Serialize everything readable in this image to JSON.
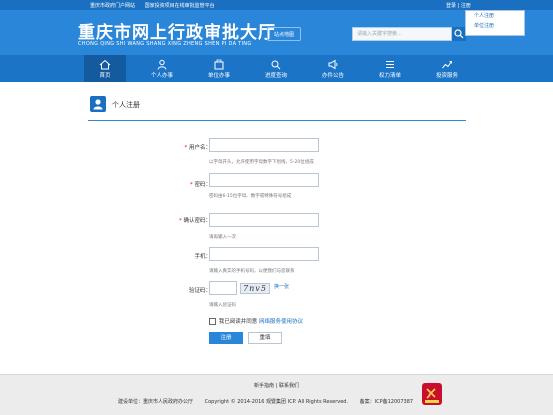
{
  "topbar": {
    "portal": "重庆市政府门户网站",
    "platform": "国家投资项目在线审批监管平台",
    "login": "登录",
    "sep": "|",
    "register": "注册"
  },
  "register_dropdown": {
    "personal": "个人注册",
    "entity": "单位注册"
  },
  "header": {
    "logo_cn": "重庆市网上行政审批大厅",
    "logo_en": "CHONG QING SHI WANG SHANG XING ZHENG SHEN PI DA TING",
    "sitemap": "站点地图",
    "search_placeholder": "请输入关键字搜索..."
  },
  "nav": [
    {
      "label": "首页",
      "icon": "home-icon"
    },
    {
      "label": "个人办事",
      "icon": "person-icon"
    },
    {
      "label": "单位办事",
      "icon": "building-icon"
    },
    {
      "label": "进度查询",
      "icon": "search-icon"
    },
    {
      "label": "办件公告",
      "icon": "megaphone-icon"
    },
    {
      "label": "权力清单",
      "icon": "list-icon"
    },
    {
      "label": "投资服务",
      "icon": "investment-icon"
    }
  ],
  "page": {
    "title": "个人注册"
  },
  "form": {
    "username": {
      "label": "用户名：",
      "hint": "以字母开头，允许使用字母数字下划线，5-20位组成"
    },
    "password": {
      "label": "密码：",
      "hint": "密码由6-15位字母、数字或特殊符号组成"
    },
    "confirm": {
      "label": "确认密码：",
      "hint": "请再输入一次"
    },
    "phone": {
      "label": "手机：",
      "hint": "请输入真实的手机号码，以便我们与您联系"
    },
    "captcha": {
      "label": "验证码：",
      "image_text": "7nv5",
      "refresh": "换一张",
      "hint": "请输入验证码"
    },
    "agree_text": "我已阅读并同意",
    "agree_link": "网络服务使用协议",
    "submit": "注册",
    "reset": "重填",
    "required_mark": "*"
  },
  "footer": {
    "help": "新手指南",
    "sep": "|",
    "contact": "联系我们",
    "org": "建设单位：重庆市人民政府办公厅",
    "copyright": "Copyright © 2014-2016 观暨集团 ICP. All Rights Reserved.",
    "icp": "备案：ICP备12007387"
  },
  "colors": {
    "brand": "#2a86d8",
    "nav": "#1b74c6",
    "nav_active": "#135a9e",
    "required": "#e00000"
  }
}
